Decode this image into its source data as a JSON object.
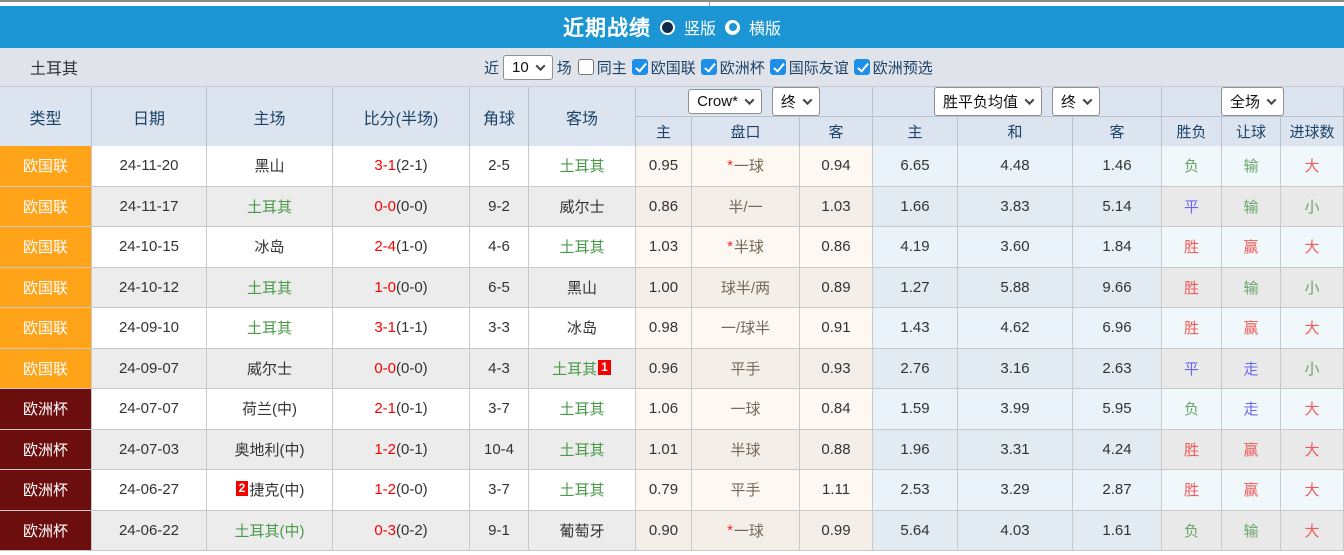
{
  "colors": {
    "topbar_blue": "#1b95d3",
    "type_badge_orange": "#ffa319",
    "type_badge_maroon": "#6d0e0e",
    "team_green": "#4a9a4a",
    "score_red": "#fb0000",
    "result_red": "#f15a5a",
    "result_green": "#6aa56a",
    "result_blue": "#6c66ee",
    "checkbox_blue": "#1e8fe9"
  },
  "titlebar": {
    "title": "近期战绩",
    "vertical_label": "竖版",
    "horizontal_label": "横版",
    "selected_option": "竖版"
  },
  "filterbar": {
    "team": "土耳其",
    "near_label": "近",
    "near_count": "10",
    "games_label": "场",
    "checkboxes": [
      {
        "label": "同主",
        "checked": false
      },
      {
        "label": "欧国联",
        "checked": true
      },
      {
        "label": "欧洲杯",
        "checked": true
      },
      {
        "label": "国际友谊",
        "checked": true
      },
      {
        "label": "欧洲预选",
        "checked": true
      }
    ]
  },
  "table": {
    "main_headers": [
      "类型",
      "日期",
      "主场",
      "比分(半场)",
      "角球",
      "客场"
    ],
    "selects": {
      "odds_provider": "Crow*",
      "odds_time": "终",
      "mean_type": "胜平负均值",
      "mean_time": "终",
      "scope": "全场"
    },
    "sub_headers": [
      "主",
      "盘口",
      "客",
      "主",
      "和",
      "客",
      "胜负",
      "让球",
      "进球数"
    ],
    "rows": [
      {
        "type": "欧国联",
        "type_style": "orange",
        "date": "24-11-20",
        "home": "黑山",
        "home_green": false,
        "home_badge": "",
        "score": "3-1",
        "half": "(2-1)",
        "corners": "2-5",
        "away": "土耳其",
        "away_green": true,
        "away_badge": "",
        "odds_home": "0.95",
        "line_star": true,
        "line": "一球",
        "odds_away": "0.94",
        "mean_home": "6.65",
        "mean_draw": "4.48",
        "mean_away": "1.46",
        "result_wdl": "负",
        "result_wdl_color": "green",
        "result_handicap": "输",
        "result_handicap_color": "green",
        "result_goals": "大",
        "result_goals_color": "red"
      },
      {
        "type": "欧国联",
        "type_style": "orange",
        "date": "24-11-17",
        "home": "土耳其",
        "home_green": true,
        "home_badge": "",
        "score": "0-0",
        "half": "(0-0)",
        "corners": "9-2",
        "away": "威尔士",
        "away_green": false,
        "away_badge": "",
        "odds_home": "0.86",
        "line_star": false,
        "line": "半/一",
        "odds_away": "1.03",
        "mean_home": "1.66",
        "mean_draw": "3.83",
        "mean_away": "5.14",
        "result_wdl": "平",
        "result_wdl_color": "blue",
        "result_handicap": "输",
        "result_handicap_color": "green",
        "result_goals": "小",
        "result_goals_color": "green"
      },
      {
        "type": "欧国联",
        "type_style": "orange",
        "date": "24-10-15",
        "home": "冰岛",
        "home_green": false,
        "home_badge": "",
        "score": "2-4",
        "half": "(1-0)",
        "corners": "4-6",
        "away": "土耳其",
        "away_green": true,
        "away_badge": "",
        "odds_home": "1.03",
        "line_star": true,
        "line": "半球",
        "odds_away": "0.86",
        "mean_home": "4.19",
        "mean_draw": "3.60",
        "mean_away": "1.84",
        "result_wdl": "胜",
        "result_wdl_color": "red",
        "result_handicap": "赢",
        "result_handicap_color": "red",
        "result_goals": "大",
        "result_goals_color": "red"
      },
      {
        "type": "欧国联",
        "type_style": "orange",
        "date": "24-10-12",
        "home": "土耳其",
        "home_green": true,
        "home_badge": "",
        "score": "1-0",
        "half": "(0-0)",
        "corners": "6-5",
        "away": "黑山",
        "away_green": false,
        "away_badge": "",
        "odds_home": "1.00",
        "line_star": false,
        "line": "球半/两",
        "odds_away": "0.89",
        "mean_home": "1.27",
        "mean_draw": "5.88",
        "mean_away": "9.66",
        "result_wdl": "胜",
        "result_wdl_color": "red",
        "result_handicap": "输",
        "result_handicap_color": "green",
        "result_goals": "小",
        "result_goals_color": "green"
      },
      {
        "type": "欧国联",
        "type_style": "orange",
        "date": "24-09-10",
        "home": "土耳其",
        "home_green": true,
        "home_badge": "",
        "score": "3-1",
        "half": "(1-1)",
        "corners": "3-3",
        "away": "冰岛",
        "away_green": false,
        "away_badge": "",
        "odds_home": "0.98",
        "line_star": false,
        "line": "一/球半",
        "odds_away": "0.91",
        "mean_home": "1.43",
        "mean_draw": "4.62",
        "mean_away": "6.96",
        "result_wdl": "胜",
        "result_wdl_color": "red",
        "result_handicap": "赢",
        "result_handicap_color": "red",
        "result_goals": "大",
        "result_goals_color": "red"
      },
      {
        "type": "欧国联",
        "type_style": "orange",
        "date": "24-09-07",
        "home": "威尔士",
        "home_green": false,
        "home_badge": "",
        "score": "0-0",
        "half": "(0-0)",
        "corners": "4-3",
        "away": "土耳其",
        "away_green": true,
        "away_badge": "1",
        "odds_home": "0.96",
        "line_star": false,
        "line": "平手",
        "odds_away": "0.93",
        "mean_home": "2.76",
        "mean_draw": "3.16",
        "mean_away": "2.63",
        "result_wdl": "平",
        "result_wdl_color": "blue",
        "result_handicap": "走",
        "result_handicap_color": "blue",
        "result_goals": "小",
        "result_goals_color": "green"
      },
      {
        "type": "欧洲杯",
        "type_style": "maroon",
        "date": "24-07-07",
        "home": "荷兰(中)",
        "home_green": false,
        "home_badge": "",
        "score": "2-1",
        "half": "(0-1)",
        "corners": "3-7",
        "away": "土耳其",
        "away_green": true,
        "away_badge": "",
        "odds_home": "1.06",
        "line_star": false,
        "line": "一球",
        "odds_away": "0.84",
        "mean_home": "1.59",
        "mean_draw": "3.99",
        "mean_away": "5.95",
        "result_wdl": "负",
        "result_wdl_color": "green",
        "result_handicap": "走",
        "result_handicap_color": "blue",
        "result_goals": "大",
        "result_goals_color": "red"
      },
      {
        "type": "欧洲杯",
        "type_style": "maroon",
        "date": "24-07-03",
        "home": "奥地利(中)",
        "home_green": false,
        "home_badge": "",
        "score": "1-2",
        "half": "(0-1)",
        "corners": "10-4",
        "away": "土耳其",
        "away_green": true,
        "away_badge": "",
        "odds_home": "1.01",
        "line_star": false,
        "line": "半球",
        "odds_away": "0.88",
        "mean_home": "1.96",
        "mean_draw": "3.31",
        "mean_away": "4.24",
        "result_wdl": "胜",
        "result_wdl_color": "red",
        "result_handicap": "赢",
        "result_handicap_color": "red",
        "result_goals": "大",
        "result_goals_color": "red"
      },
      {
        "type": "欧洲杯",
        "type_style": "maroon",
        "date": "24-06-27",
        "home": "捷克(中)",
        "home_green": false,
        "home_badge": "2",
        "score": "1-2",
        "half": "(0-0)",
        "corners": "3-7",
        "away": "土耳其",
        "away_green": true,
        "away_badge": "",
        "odds_home": "0.79",
        "line_star": false,
        "line": "平手",
        "odds_away": "1.11",
        "mean_home": "2.53",
        "mean_draw": "3.29",
        "mean_away": "2.87",
        "result_wdl": "胜",
        "result_wdl_color": "red",
        "result_handicap": "赢",
        "result_handicap_color": "red",
        "result_goals": "大",
        "result_goals_color": "red"
      },
      {
        "type": "欧洲杯",
        "type_style": "maroon",
        "date": "24-06-22",
        "home": "土耳其(中)",
        "home_green": true,
        "home_badge": "",
        "score": "0-3",
        "half": "(0-2)",
        "corners": "9-1",
        "away": "葡萄牙",
        "away_green": false,
        "away_badge": "",
        "odds_home": "0.90",
        "line_star": true,
        "line": "一球",
        "odds_away": "0.99",
        "mean_home": "5.64",
        "mean_draw": "4.03",
        "mean_away": "1.61",
        "result_wdl": "负",
        "result_wdl_color": "green",
        "result_handicap": "输",
        "result_handicap_color": "green",
        "result_goals": "大",
        "result_goals_color": "red"
      }
    ]
  }
}
